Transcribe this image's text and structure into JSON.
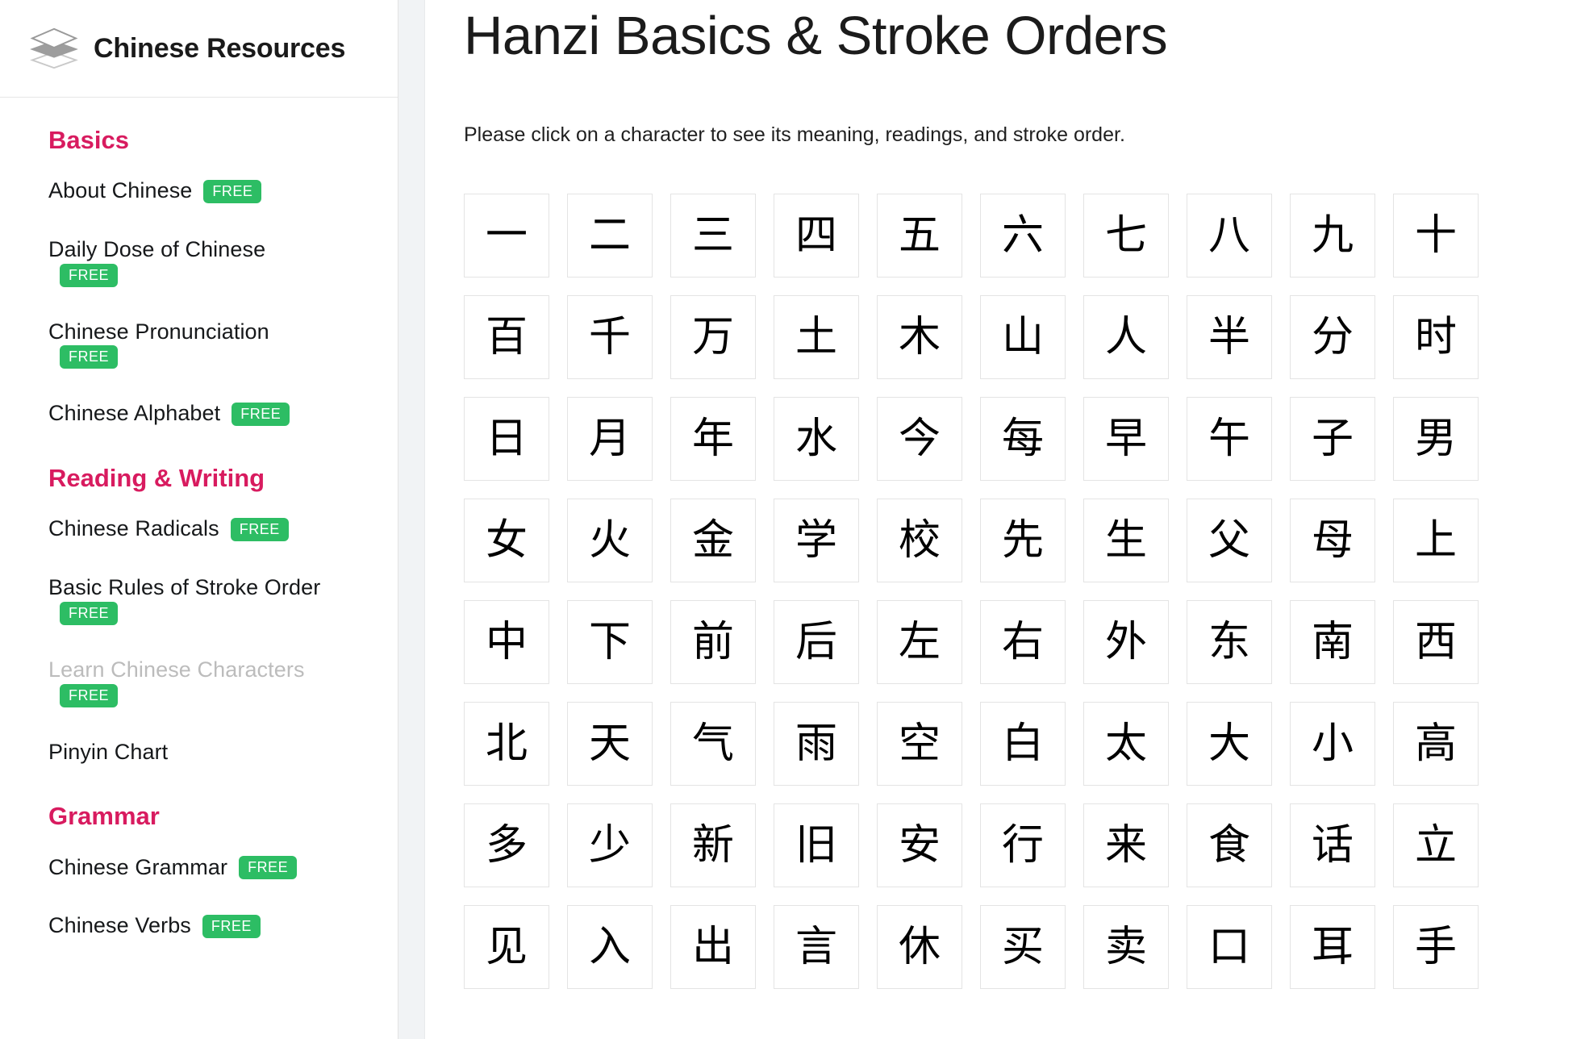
{
  "sidebar": {
    "brand": {
      "title": "Chinese Resources",
      "logo_icon": "layers-stack-icon"
    },
    "accent_heading_color": "#d81b5f",
    "badge_color": "#2dbd64",
    "badge_label": "FREE",
    "sections": [
      {
        "title": "Basics",
        "items": [
          {
            "label": "About Chinese",
            "badge": "FREE",
            "disabled": false
          },
          {
            "label": "Daily Dose of Chinese",
            "badge": "FREE",
            "disabled": false
          },
          {
            "label": "Chinese Pronunciation",
            "badge": "FREE",
            "disabled": false
          },
          {
            "label": "Chinese Alphabet",
            "badge": "FREE",
            "disabled": false
          }
        ]
      },
      {
        "title": "Reading & Writing",
        "items": [
          {
            "label": "Chinese Radicals",
            "badge": "FREE",
            "disabled": false
          },
          {
            "label": "Basic Rules of Stroke Order",
            "badge": "FREE",
            "disabled": false
          },
          {
            "label": "Learn Chinese Characters",
            "badge": "FREE",
            "disabled": true
          },
          {
            "label": "Pinyin Chart",
            "badge": null,
            "disabled": false
          }
        ]
      },
      {
        "title": "Grammar",
        "items": [
          {
            "label": "Chinese Grammar",
            "badge": "FREE",
            "disabled": false
          },
          {
            "label": "Chinese Verbs",
            "badge": "FREE",
            "disabled": false
          }
        ]
      }
    ]
  },
  "main": {
    "title": "Hanzi Basics & Stroke Orders",
    "intro": "Please click on a character to see its meaning, readings, and stroke order.",
    "grid": {
      "columns": 10,
      "rows": 8,
      "characters": [
        "一",
        "二",
        "三",
        "四",
        "五",
        "六",
        "七",
        "八",
        "九",
        "十",
        "百",
        "千",
        "万",
        "土",
        "木",
        "山",
        "人",
        "半",
        "分",
        "时",
        "日",
        "月",
        "年",
        "水",
        "今",
        "每",
        "早",
        "午",
        "子",
        "男",
        "女",
        "火",
        "金",
        "学",
        "校",
        "先",
        "生",
        "父",
        "母",
        "上",
        "中",
        "下",
        "前",
        "后",
        "左",
        "右",
        "外",
        "东",
        "南",
        "西",
        "北",
        "天",
        "气",
        "雨",
        "空",
        "白",
        "太",
        "大",
        "小",
        "高",
        "多",
        "少",
        "新",
        "旧",
        "安",
        "行",
        "来",
        "食",
        "话",
        "立",
        "见",
        "入",
        "出",
        "言",
        "休",
        "买",
        "卖",
        "口",
        "耳",
        "手"
      ]
    }
  }
}
